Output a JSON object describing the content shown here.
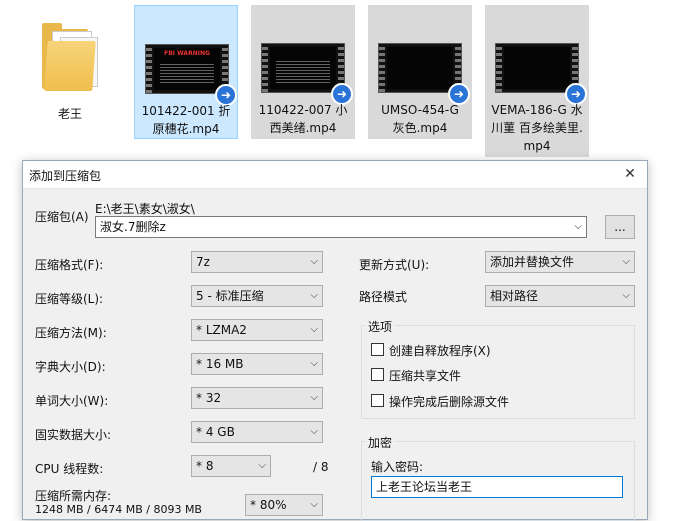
{
  "tiles": [
    {
      "name": "老王",
      "type": "folder"
    },
    {
      "name": "101422-001 折原穗花.mp4",
      "line1": "101422-001 折",
      "line2": "原穗花.mp4",
      "warn": "FBI WARNING"
    },
    {
      "name": "110422-007 小西美绪.mp4",
      "line1": "110422-007 小",
      "line2": "西美绪.mp4"
    },
    {
      "name": "UMSO-454-G 灰色.mp4",
      "line1": "UMSO-454-G",
      "line2": "灰色.mp4"
    },
    {
      "name": "VEMA-186-G 水川菫 百多绘美里.mp4",
      "line1": "VEMA-186-G 水",
      "line2": "川菫 百多绘美里.",
      "line3": "mp4"
    }
  ],
  "dialog": {
    "title": "添加到压缩包",
    "archive_label": "压缩包(A)",
    "archive_path": "E:\\老王\\素女\\淑女\\",
    "archive_name": "淑女.7删除z",
    "browse_label": "...",
    "format": {
      "label": "压缩格式(F):",
      "value": "7z"
    },
    "level": {
      "label": "压缩等级(L):",
      "value": "5 - 标准压缩"
    },
    "method": {
      "label": "压缩方法(M):",
      "value": "* LZMA2"
    },
    "dict": {
      "label": "字典大小(D):",
      "value": "* 16 MB"
    },
    "word": {
      "label": "单词大小(W):",
      "value": "* 32"
    },
    "solid": {
      "label": "固实数据大小:",
      "value": "* 4 GB"
    },
    "threads": {
      "label": "CPU 线程数:",
      "value": "* 8",
      "max": "/ 8"
    },
    "memory": {
      "label": "压缩所需内存:",
      "detail": "1248 MB / 6474 MB / 8093 MB",
      "value": "* 80%"
    },
    "update": {
      "label": "更新方式(U):",
      "value": "添加并替换文件"
    },
    "path_mode": {
      "label": "路径模式",
      "value": "相对路径"
    },
    "options": {
      "title": "选项",
      "items": [
        "创建自释放程序(X)",
        "压缩共享文件",
        "操作完成后删除源文件"
      ]
    },
    "encryption": {
      "title": "加密",
      "password_label": "输入密码:",
      "password_value": "上老王论坛当老王"
    }
  }
}
